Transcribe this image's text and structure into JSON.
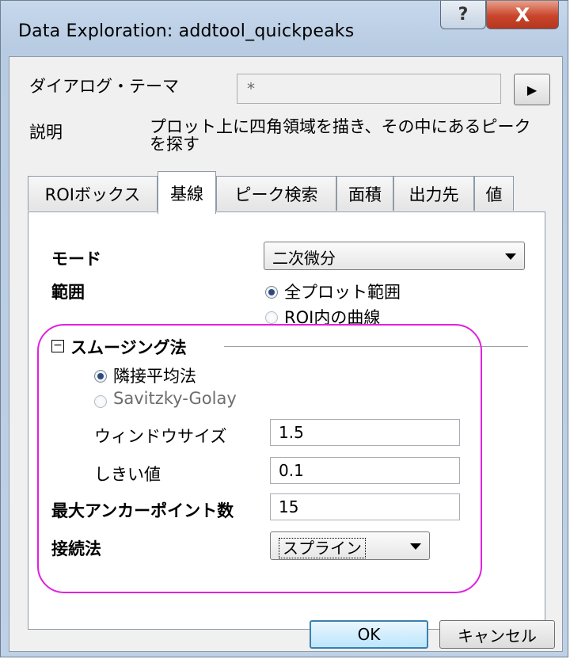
{
  "window": {
    "title": "Data Exploration: addtool_quickpeaks",
    "help_glyph": "?",
    "close_glyph": "X"
  },
  "theme": {
    "label": "ダイアログ・テーマ",
    "value": "*",
    "arrow": "▶"
  },
  "description": {
    "label": "説明",
    "text_line1": "プロット上に四角領域を描き、その中にあるピーク",
    "text_line2": "を探す"
  },
  "tabs": [
    "ROIボックス",
    "基線",
    "ピーク検索",
    "面積",
    "出力先",
    "値"
  ],
  "active_tab": "基線",
  "form": {
    "mode_label": "モード",
    "mode_value": "二次微分",
    "range_label": "範囲",
    "range_options": [
      "全プロット範囲",
      "ROI内の曲線"
    ],
    "smoothing_label": "スムージング法",
    "collapse_glyph": "−",
    "smoothing_options": [
      "隣接平均法",
      "Savitzky-Golay"
    ],
    "window_size_label": "ウィンドウサイズ",
    "window_size_value": "1.5",
    "threshold_label": "しきい値",
    "threshold_value": "0.1",
    "max_anchor_label": "最大アンカーポイント数",
    "max_anchor_value": "15",
    "connect_label": "接続法",
    "connect_value": "スプライン"
  },
  "buttons": {
    "ok": "OK",
    "cancel": "キャンセル"
  },
  "colors": {
    "highlight": "#e020e0",
    "title_bar": "#bfd1e6",
    "close_button": "#c9452b"
  }
}
